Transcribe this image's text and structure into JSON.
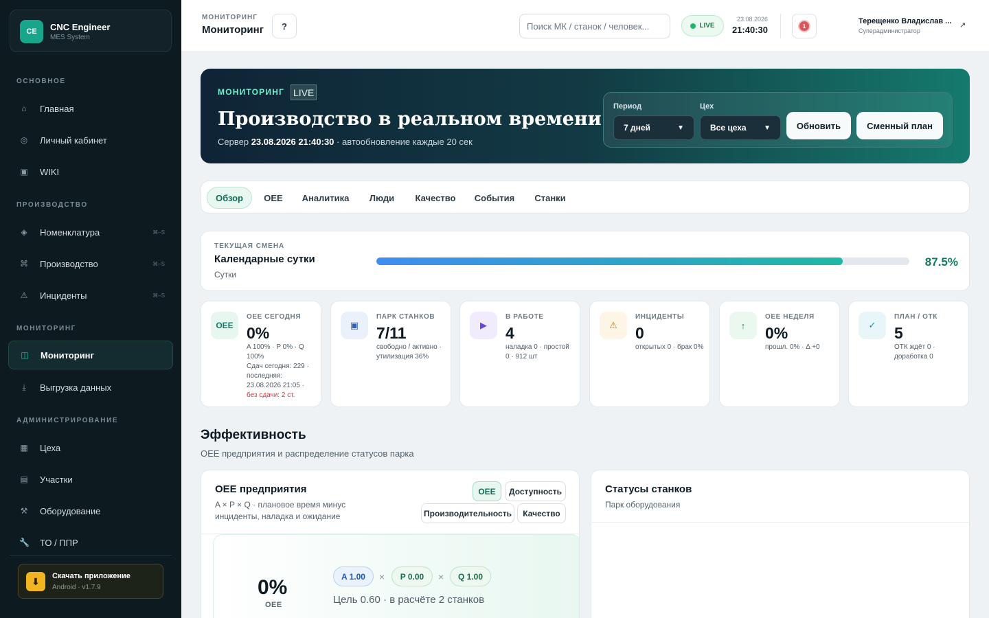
{
  "brand": {
    "logo": "CE",
    "title": "CNC Engineer",
    "subtitle": "MES System"
  },
  "sidebar": {
    "sections": [
      {
        "title": "ОСНОВНОЕ"
      },
      {
        "title": "ПРОИЗВОДСТВО"
      },
      {
        "title": "МОНИТОРИНГ"
      },
      {
        "title": "АДМИНИСТРИРОВАНИЕ"
      }
    ],
    "items": [
      {
        "label": "Главная",
        "icon": "home-icon",
        "glyph": "⌂"
      },
      {
        "label": "Личный кабинет",
        "icon": "user-circle-icon",
        "glyph": "◎"
      },
      {
        "label": "WIKI",
        "icon": "book-icon",
        "glyph": "▣"
      },
      {
        "label": "Номенклатура",
        "icon": "diamond-icon",
        "glyph": "◈",
        "shortcut": "⌘–S"
      },
      {
        "label": "Производство",
        "icon": "command-icon",
        "glyph": "⌘",
        "shortcut": "⌘–S"
      },
      {
        "label": "Инциденты",
        "icon": "warning-icon",
        "glyph": "⚠",
        "shortcut": "⌘–S"
      },
      {
        "label": "Мониторинг",
        "icon": "columns-icon",
        "glyph": "◫"
      },
      {
        "label": "Выгрузка данных",
        "icon": "download-icon",
        "glyph": "⤓"
      },
      {
        "label": "Цеха",
        "icon": "grid-icon",
        "glyph": "▦"
      },
      {
        "label": "Участки",
        "icon": "list-icon",
        "glyph": "▤"
      },
      {
        "label": "Оборудование",
        "icon": "tools-icon",
        "glyph": "⚒"
      },
      {
        "label": "ТО / ППР",
        "icon": "wrench-icon",
        "glyph": "🔧"
      }
    ],
    "app": {
      "title": "Скачать приложение",
      "subtitle": "Android · v1.7.9",
      "glyph": "⬇"
    }
  },
  "topbar": {
    "crumb": "МОНИТОРИНГ",
    "title": "Мониторинг",
    "help": "?",
    "search_placeholder": "Поиск МК / станок / человек...",
    "live": "LIVE",
    "date": "23.08.2026",
    "time": "21:40:30",
    "notifications": "1",
    "user_name": "Терещенко Владислав ...",
    "user_role": "Суперадминистратор",
    "user_link": "↗"
  },
  "hero": {
    "kicker": "МОНИТОРИНГ",
    "live": "LIVE",
    "title": "Производство в реальном времени",
    "server_prefix": "Сервер",
    "server_time": "23.08.2026 21:40:30",
    "refresh_note": "· автообновление каждые 20 сек",
    "period_label": "Период",
    "period_value": "7 дней",
    "shop_label": "Цех",
    "shop_value": "Все цеха",
    "refresh_button": "Обновить",
    "plan_button": "Сменный план"
  },
  "tabs": [
    {
      "label": "Обзор"
    },
    {
      "label": "OEE"
    },
    {
      "label": "Аналитика"
    },
    {
      "label": "Люди"
    },
    {
      "label": "Качество"
    },
    {
      "label": "События"
    },
    {
      "label": "Станки"
    }
  ],
  "shift": {
    "kicker": "ТЕКУЩАЯ СМЕНА",
    "title": "Календарные сутки",
    "subtitle": "Сутки",
    "progress": 87.5,
    "progress_label": "87.5%"
  },
  "kpis": [
    {
      "label": "OEE СЕГОДНЯ",
      "value": "0%",
      "icon": "oee-badge-icon",
      "glyph": "OEE",
      "color": "#0f7c63",
      "bg": "#e8f6f0",
      "note": "A 100% · P 0% · Q 100%",
      "note2": "Сдач сегодня: 229 · последняя: 23.08.2026 21:05 ·",
      "note3": "без сдачи: 2 ст."
    },
    {
      "label": "ПАРК СТАНКОВ",
      "value": "7/11",
      "icon": "machine-icon",
      "glyph": "▣",
      "color": "#2f5fb5",
      "bg": "#ebf1fb",
      "note": "свободно / активно · утилизация 36%"
    },
    {
      "label": "В РАБОТЕ",
      "value": "4",
      "icon": "play-icon",
      "glyph": "▶",
      "color": "#6b46d6",
      "bg": "#f1ecfd",
      "note": "наладка 0 · простой 0 · 912 шт"
    },
    {
      "label": "ИНЦИДЕНТЫ",
      "value": "0",
      "icon": "warning-icon",
      "glyph": "⚠",
      "color": "#c97a10",
      "bg": "#fdf5e6",
      "note": "открытых 0 · брак 0%"
    },
    {
      "label": "OEE НЕДЕЛЯ",
      "value": "0%",
      "icon": "arrow-up-icon",
      "glyph": "↑",
      "color": "#1b8a55",
      "bg": "#ebf8f0",
      "note": "прошл. 0% · Δ +0"
    },
    {
      "label": "ПЛАН / ОТК",
      "value": "5",
      "icon": "check-icon",
      "glyph": "✓",
      "color": "#1a8fb0",
      "bg": "#e8f6fa",
      "note": "ОТК ждёт 0 · доработка 0"
    }
  ],
  "section": {
    "title": "Эффективность",
    "subtitle": "OEE предприятия и распределение статусов парка"
  },
  "oee_card": {
    "title": "OEE предприятия",
    "description": "A × P × Q · плановое время минус инциденты, наладка и ожидание",
    "pills": [
      {
        "label": "OEE"
      },
      {
        "label": "Доступность"
      },
      {
        "label": "Производительность"
      },
      {
        "label": "Качество"
      }
    ],
    "big_value": "0%",
    "big_label": "OEE",
    "chip_a": "A 1.00",
    "chip_p": "P 0.00",
    "chip_q": "Q 1.00",
    "times": "×",
    "target": "Цель 0.60 · в расчёте 2 станков"
  },
  "status_card": {
    "title": "Статусы станков",
    "subtitle": "Парк оборудования"
  }
}
